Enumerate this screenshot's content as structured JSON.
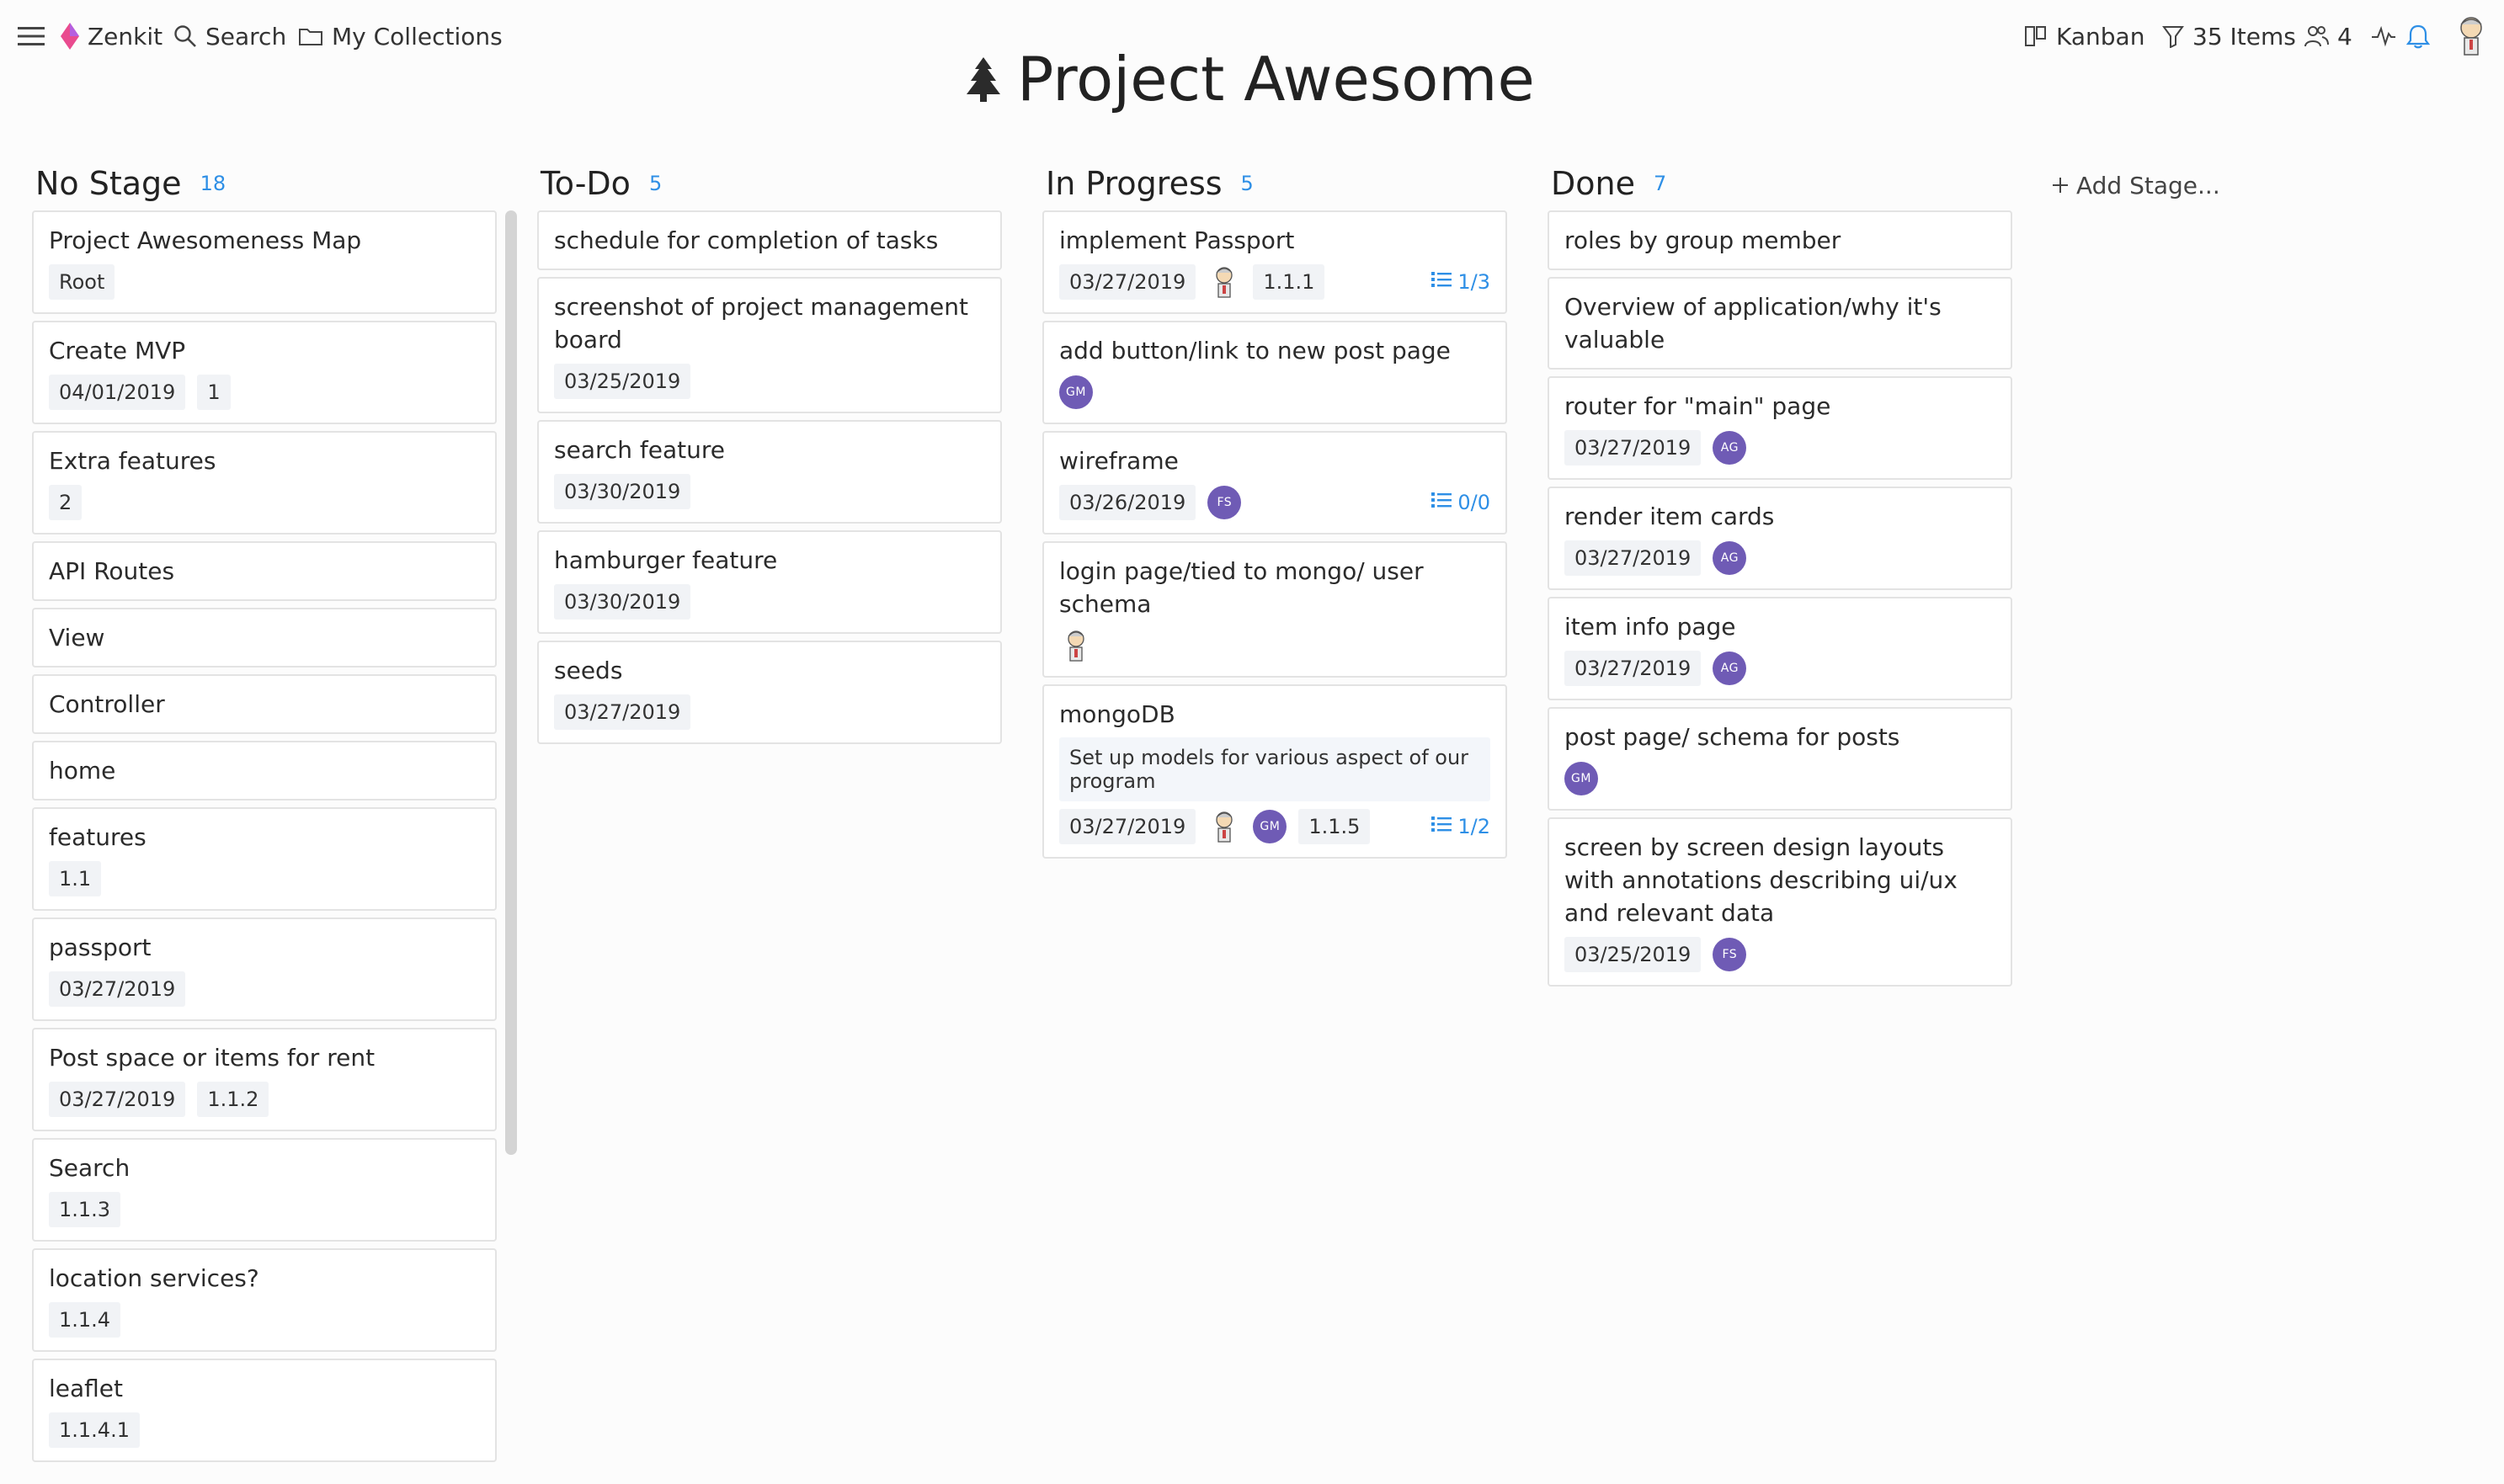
{
  "nav": {
    "brand": "Zenkit",
    "search": "Search",
    "collections": "My Collections",
    "view": "Kanban",
    "items": "35 Items",
    "members": "4"
  },
  "title": "Project Awesome",
  "colors": {
    "accent": "#2e8fe6",
    "avatar": "#6f5bb5",
    "brand": "#e94b8f"
  },
  "columns": [
    {
      "title": "No Stage",
      "count": "18",
      "cards": [
        {
          "title": "Project Awesomeness Map",
          "chips": [
            "Root"
          ]
        },
        {
          "title": "Create MVP",
          "chips": [
            "04/01/2019",
            "1"
          ]
        },
        {
          "title": "Extra features",
          "chips": [
            "2"
          ]
        },
        {
          "title": "API Routes"
        },
        {
          "title": "View"
        },
        {
          "title": "Controller"
        },
        {
          "title": "home"
        },
        {
          "title": "features",
          "chips": [
            "1.1"
          ]
        },
        {
          "title": "passport",
          "chips": [
            "03/27/2019"
          ]
        },
        {
          "title": "Post space or items for rent",
          "chips": [
            "03/27/2019",
            "1.1.2"
          ]
        },
        {
          "title": "Search",
          "chips": [
            "1.1.3"
          ]
        },
        {
          "title": "location services?",
          "chips": [
            "1.1.4"
          ]
        },
        {
          "title": "leaflet",
          "chips": [
            "1.1.4.1"
          ]
        }
      ]
    },
    {
      "title": "To-Do",
      "count": "5",
      "cards": [
        {
          "title": "schedule for completion of tasks"
        },
        {
          "title": "screenshot of project management board",
          "chips": [
            "03/25/2019"
          ]
        },
        {
          "title": "search feature",
          "chips": [
            "03/30/2019"
          ]
        },
        {
          "title": "hamburger feature",
          "chips": [
            "03/30/2019"
          ]
        },
        {
          "title": "seeds",
          "chips": [
            "03/27/2019"
          ]
        }
      ]
    },
    {
      "title": "In Progress",
      "count": "5",
      "cards": [
        {
          "title": "implement Passport",
          "chips": [
            "03/27/2019"
          ],
          "avatars": [
            "img"
          ],
          "chips_after": [
            "1.1.1"
          ],
          "checklist": "1/3"
        },
        {
          "title": "add button/link to new post page",
          "avatars": [
            "GM"
          ]
        },
        {
          "title": "wireframe",
          "chips": [
            "03/26/2019"
          ],
          "avatars": [
            "FS"
          ],
          "checklist": "0/0"
        },
        {
          "title": "login page/tied to mongo/ user schema",
          "avatars": [
            "img"
          ]
        },
        {
          "title": "mongoDB",
          "desc": "Set up models for various aspect of our program",
          "chips": [
            "03/27/2019"
          ],
          "avatars": [
            "img",
            "GM"
          ],
          "chips_after": [
            "1.1.5"
          ],
          "checklist": "1/2"
        }
      ]
    },
    {
      "title": "Done",
      "count": "7",
      "cards": [
        {
          "title": "roles by group member"
        },
        {
          "title": "Overview of application/why it's valuable"
        },
        {
          "title": "router for \"main\" page",
          "chips": [
            "03/27/2019"
          ],
          "avatars": [
            "AG"
          ]
        },
        {
          "title": "render item cards",
          "chips": [
            "03/27/2019"
          ],
          "avatars": [
            "AG"
          ]
        },
        {
          "title": "item info page",
          "chips": [
            "03/27/2019"
          ],
          "avatars": [
            "AG"
          ]
        },
        {
          "title": "post page/ schema for posts",
          "avatars": [
            "GM"
          ]
        },
        {
          "title": "screen by screen design layouts with annotations describing ui/ux and relevant data",
          "chips": [
            "03/25/2019"
          ],
          "avatars": [
            "FS"
          ]
        }
      ]
    }
  ],
  "add_stage": "Add Stage..."
}
